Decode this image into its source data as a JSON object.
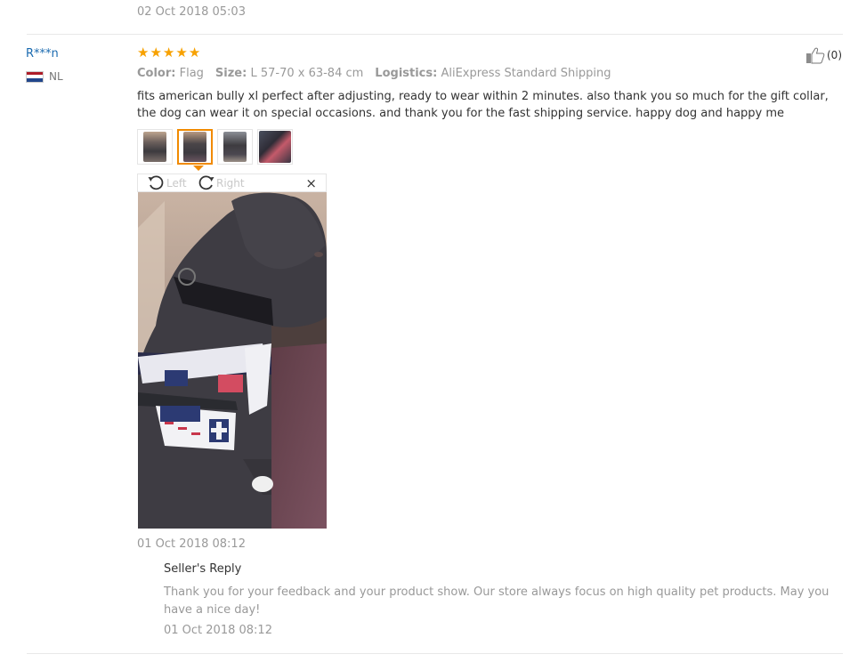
{
  "previous_review": {
    "date": "02 Oct 2018 05:03"
  },
  "review": {
    "user": {
      "name": "R***n",
      "country_code": "NL"
    },
    "rating": {
      "stars": 5,
      "max": 5,
      "glyph": "★",
      "color": "#f7a100"
    },
    "helpful": {
      "count_label": "(0)",
      "icon": "thumbs-up-icon"
    },
    "meta": {
      "color_label": "Color:",
      "color_value": "Flag",
      "size_label": "Size:",
      "size_value": "L 57-70 x 63-84 cm",
      "logistics_label": "Logistics:",
      "logistics_value": "AliExpress Standard Shipping"
    },
    "text": "fits american bully xl perfect after adjusting, ready to wear within 2 minutes. also thank you so much for the gift collar, the dog can wear it on special occasions. and thank you for the fast shipping service. happy dog and happy me",
    "thumbnails": [
      {
        "active": false
      },
      {
        "active": true
      },
      {
        "active": false
      },
      {
        "active": false
      }
    ],
    "viewer": {
      "rotate_left_label": "Left",
      "rotate_right_label": "Right",
      "close_glyph": "×"
    },
    "date": "01 Oct 2018 08:12",
    "seller_reply": {
      "title": "Seller's Reply",
      "text": "Thank you for your feedback and your product show. Our store always focus on high quality pet products. May you have a nice day!",
      "date": "01 Oct 2018 08:12"
    }
  },
  "colors": {
    "accent": "#f18a00",
    "link": "#1a6ab0",
    "muted": "#999999",
    "star": "#f7a100"
  }
}
